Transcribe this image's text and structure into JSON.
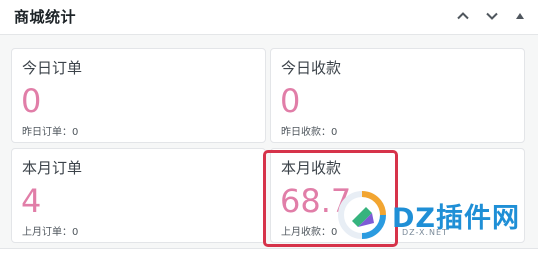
{
  "widget": {
    "title": "商城统计",
    "controls": {
      "up_icon": "chevron-up-icon",
      "down_icon": "chevron-down-icon",
      "toggle_icon": "triangle-up-icon"
    }
  },
  "cards": [
    {
      "label": "今日订单",
      "value": "0",
      "sub": "昨日订单：0"
    },
    {
      "label": "今日收款",
      "value": "0",
      "sub": "昨日收款：0"
    },
    {
      "label": "本月订单",
      "value": "4",
      "sub": "上月订单：0"
    },
    {
      "label": "本月收款",
      "value": "68.7",
      "sub": "上月收款：0"
    }
  ],
  "watermark": {
    "text": "DZ插件网",
    "domain": "DZ-X.NET"
  },
  "colors": {
    "value": "#e17ea8",
    "highlight": "#d6334a",
    "brand": "#1f8fd6"
  }
}
